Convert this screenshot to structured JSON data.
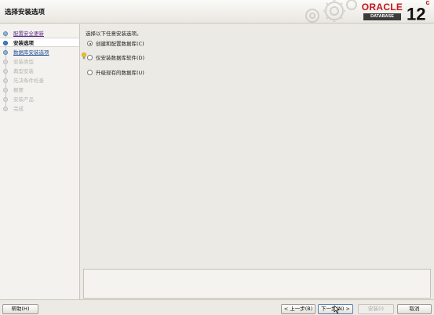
{
  "header": {
    "title": "选择安装选项",
    "logo_word": "ORACLE",
    "logo_sub": "DATABASE",
    "version": "12",
    "version_sup": "c"
  },
  "nav": {
    "items": [
      {
        "label": "配置安全更新",
        "state": "done"
      },
      {
        "label": "安装选项",
        "state": "current"
      },
      {
        "label": "数据库安装选项",
        "state": "link"
      },
      {
        "label": "安装类型",
        "state": "future"
      },
      {
        "label": "典型安装",
        "state": "future"
      },
      {
        "label": "先决条件检查",
        "state": "future"
      },
      {
        "label": "概要",
        "state": "future"
      },
      {
        "label": "安装产品",
        "state": "future"
      },
      {
        "label": "完成",
        "state": "future"
      }
    ]
  },
  "main": {
    "prompt": "选择以下任意安装选项。",
    "options": [
      {
        "label": "创建和配置数据库(C)",
        "checked": true
      },
      {
        "label": "仅安装数据库软件(D)",
        "checked": false
      },
      {
        "label": "升级现有的数据库(U)",
        "checked": false
      }
    ]
  },
  "buttons": {
    "help": "帮助(H)",
    "back": "< 上一步(B)",
    "next": "下一步(N) >",
    "install": "安装(I)",
    "cancel": "取消"
  },
  "colors": {
    "oracle_red": "#c4161c",
    "nav_current_bullet": "#3f80c7",
    "link_blue": "#1f4e9a"
  }
}
